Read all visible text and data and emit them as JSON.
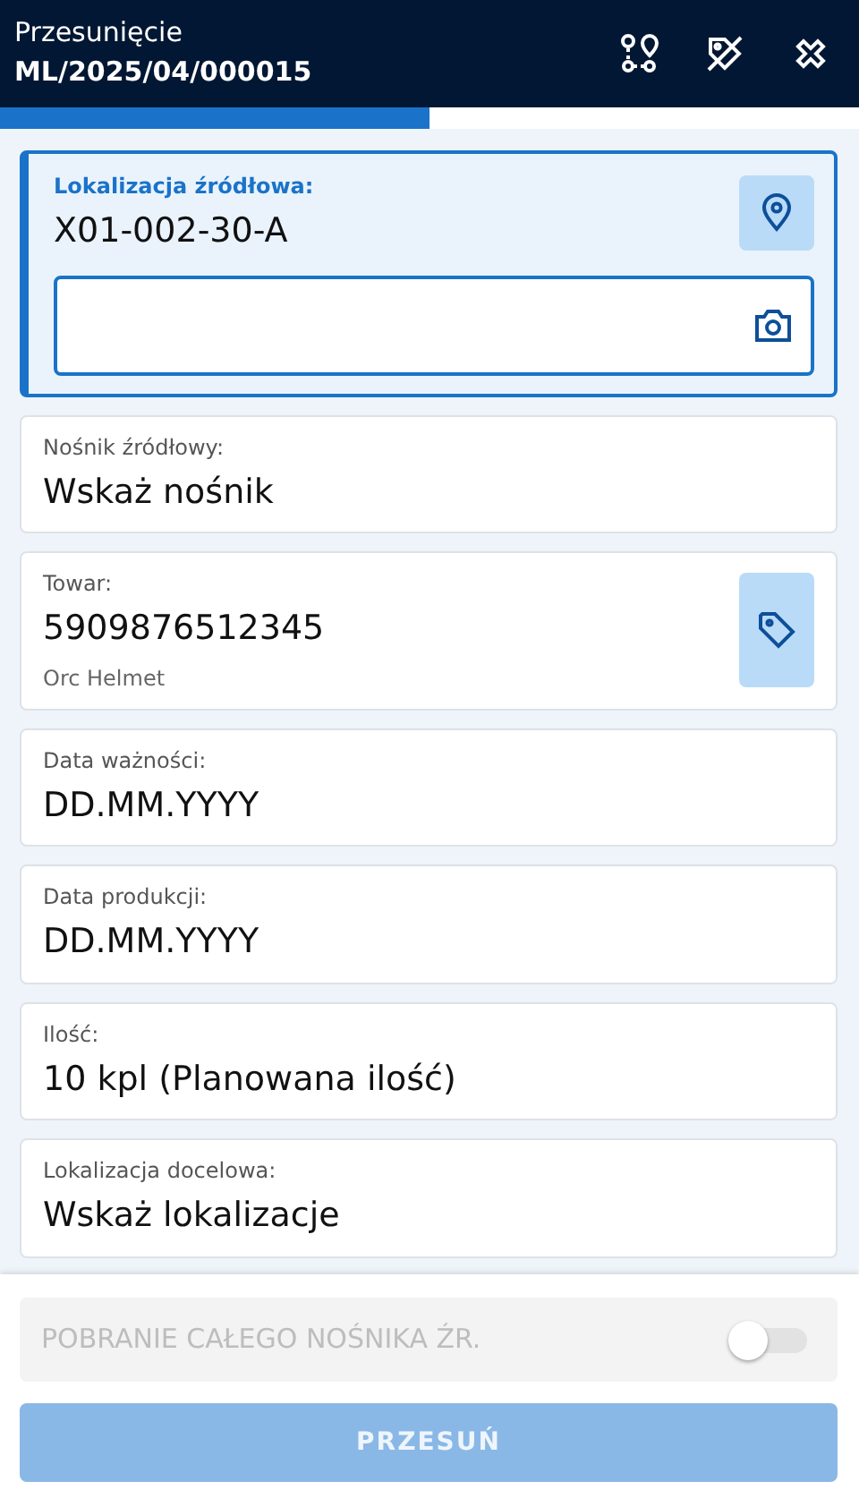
{
  "header": {
    "title": "Przesunięcie",
    "document": "ML/2025/04/000015"
  },
  "progress": {
    "level": 0.5
  },
  "fields": [
    {
      "kind": "active",
      "label": "Lokalizacja źródłowa:",
      "value": "X01-002-30-A"
    },
    {
      "kind": "plain",
      "label": "Nośnik źródłowy:",
      "value": "Wskaż nośnik"
    },
    {
      "kind": "product",
      "label": "Towar:",
      "value": "5909876512345",
      "subtitle": "Orc Helmet"
    },
    {
      "kind": "plain",
      "label": "Data ważności:",
      "value": "DD.MM.YYYY"
    },
    {
      "kind": "plain",
      "label": "Data produkcji:",
      "value": "DD.MM.YYYY"
    },
    {
      "kind": "plain",
      "label": "Ilość:",
      "value": "10 kpl (Planowana ilość)"
    },
    {
      "kind": "plain",
      "label": "Lokalizacja docelowa:",
      "value": "Wskaż lokalizacje"
    }
  ],
  "toggle": {
    "label": "POBRANIE CAŁEGO NOŚNIKA ŹR.",
    "checked": false,
    "disabled": true
  },
  "action": {
    "label": "PRZESUŃ",
    "disabled": true
  }
}
